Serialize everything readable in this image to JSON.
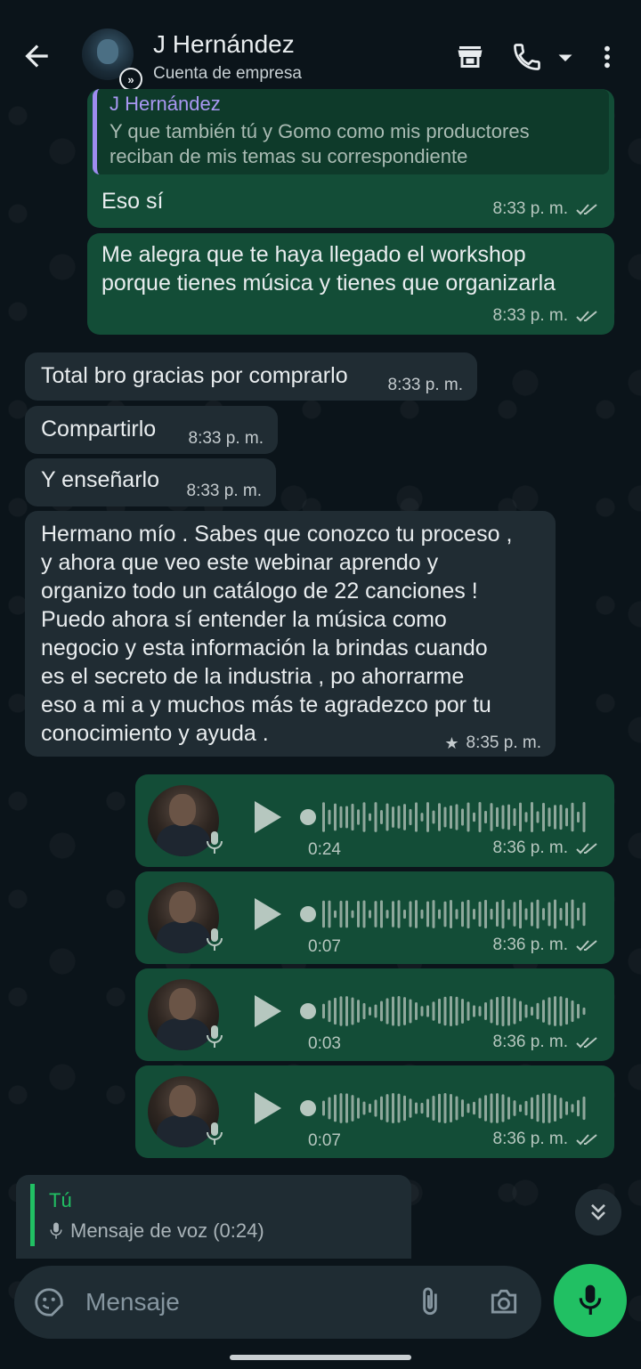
{
  "header": {
    "contact_name": "J Hernández",
    "subtitle": "Cuenta de empresa",
    "icons": [
      "back-arrow-icon",
      "store-icon",
      "phone-icon",
      "dropdown-icon",
      "more-vert-icon"
    ]
  },
  "messages": {
    "m1": {
      "quote_author": "J Hernández",
      "quote_line1": "Y que también tú y Gomo como mis productores",
      "quote_line2": "reciban de mis temas su correspondiente",
      "text": "Eso sí",
      "time": "8:33 p. m."
    },
    "m2": {
      "line1": "Me alegra que te haya llegado el workshop",
      "line2": "porque tienes música y tienes que organizarla",
      "time": "8:33 p. m."
    },
    "m3": {
      "text": "Total bro gracias por comprarlo",
      "time": "8:33 p. m."
    },
    "m4": {
      "text": "Compartirlo",
      "time": "8:33 p. m."
    },
    "m5": {
      "text": "Y enseñarlo",
      "time": "8:33 p. m."
    },
    "m6": {
      "lines": [
        "Hermano mío . Sabes que conozco tu proceso ,",
        "y ahora que veo este webinar aprendo y",
        "organizo todo un catálogo de 22 canciones !",
        "Puedo ahora sí entender la música como",
        "negocio y esta información la brindas cuando",
        "es el secreto de la industria , po ahorrarme",
        "eso a mi a y muchos más te agradezco por tu",
        "conocimiento y ayuda ."
      ],
      "starred": true,
      "time": "8:35 p. m."
    },
    "voice": [
      {
        "duration": "0:24",
        "time": "8:36 p. m."
      },
      {
        "duration": "0:07",
        "time": "8:36 p. m."
      },
      {
        "duration": "0:03",
        "time": "8:36 p. m."
      },
      {
        "duration": "0:07",
        "time": "8:36 p. m."
      }
    ]
  },
  "reply_preview": {
    "author": "Tú",
    "content": "Mensaje de voz (0:24)"
  },
  "composer": {
    "placeholder": "Mensaje"
  },
  "colors": {
    "background": "#0b141a",
    "outgoing_bubble": "#134d37",
    "incoming_bubble": "#202c33",
    "accent_green": "#21c063",
    "quote_author": "#a998f3"
  }
}
